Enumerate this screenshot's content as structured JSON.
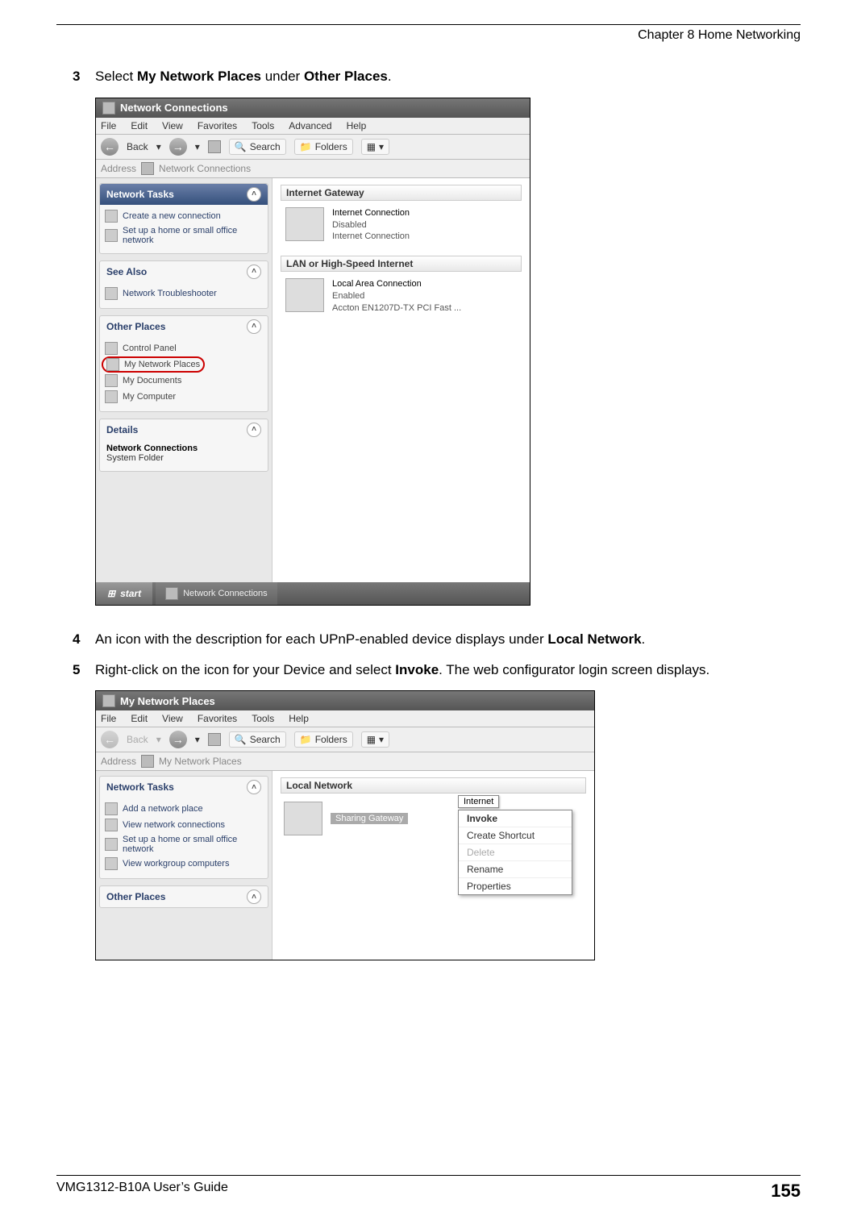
{
  "chapter": "Chapter 8 Home Networking",
  "steps": {
    "s3": {
      "num": "3",
      "pre": "Select ",
      "b1": "My Network Places",
      "mid": " under ",
      "b2": "Other Places",
      "post": "."
    },
    "s4": {
      "num": "4",
      "pre": "An icon with the description for each UPnP-enabled device displays under ",
      "b1": "Local Network",
      "post": "."
    },
    "s5": {
      "num": "5",
      "pre": "Right-click on the icon for your Device and select ",
      "b1": "Invoke",
      "post": ". The web configurator login screen displays."
    }
  },
  "shot1": {
    "title": "Network Connections",
    "menus": [
      "File",
      "Edit",
      "View",
      "Favorites",
      "Tools",
      "Advanced",
      "Help"
    ],
    "toolbar": {
      "back": "Back",
      "search": "Search",
      "folders": "Folders"
    },
    "address_label": "Address",
    "address_value": "Network Connections",
    "panels": {
      "tasks": {
        "title": "Network Tasks",
        "items": [
          "Create a new connection",
          "Set up a home or small office network"
        ]
      },
      "seealso": {
        "title": "See Also",
        "items": [
          "Network Troubleshooter"
        ]
      },
      "other": {
        "title": "Other Places",
        "items": [
          "Control Panel",
          "My Network Places",
          "My Documents",
          "My Computer"
        ]
      },
      "details": {
        "title": "Details",
        "line1": "Network Connections",
        "line2": "System Folder"
      }
    },
    "sections": {
      "gw": {
        "title": "Internet Gateway",
        "dev_name": "Internet Connection",
        "dev_status": "Disabled",
        "dev_sub": "Internet Connection"
      },
      "lan": {
        "title": "LAN or High-Speed Internet",
        "dev_name": "Local Area Connection",
        "dev_status": "Enabled",
        "dev_sub": "Accton EN1207D-TX PCI Fast ..."
      }
    },
    "taskbar": {
      "start": "start",
      "item": "Network Connections"
    }
  },
  "shot2": {
    "title": "My Network Places",
    "menus": [
      "File",
      "Edit",
      "View",
      "Favorites",
      "Tools",
      "Help"
    ],
    "toolbar": {
      "back": "Back",
      "search": "Search",
      "folders": "Folders"
    },
    "address_label": "Address",
    "address_value": "My Network Places",
    "panels": {
      "tasks": {
        "title": "Network Tasks",
        "items": [
          "Add a network place",
          "View network connections",
          "Set up a home or small office network",
          "View workgroup computers"
        ]
      },
      "other": {
        "title": "Other Places"
      }
    },
    "section_title": "Local Network",
    "device_label": "Sharing Gateway",
    "tooltip": "Internet",
    "context_menu": [
      "Invoke",
      "Create Shortcut",
      "Delete",
      "Rename",
      "Properties"
    ]
  },
  "footer": {
    "left": "VMG1312-B10A User’s Guide",
    "page": "155"
  }
}
